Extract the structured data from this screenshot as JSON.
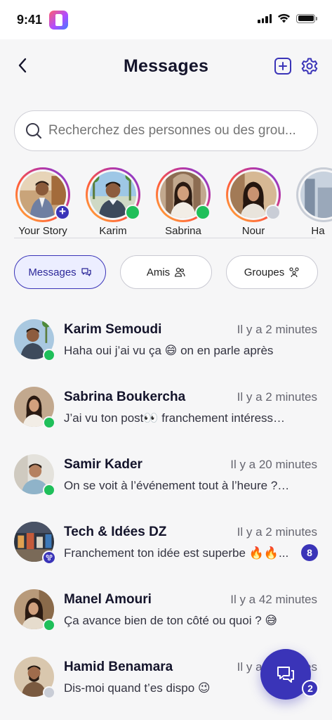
{
  "status_bar": {
    "time": "9:41"
  },
  "header": {
    "title": "Messages"
  },
  "search": {
    "placeholder": "Recherchez des personnes ou des grou..."
  },
  "stories": [
    {
      "name": "Your Story",
      "status": "add"
    },
    {
      "name": "Karim",
      "status": "online"
    },
    {
      "name": "Sabrina",
      "status": "online"
    },
    {
      "name": "Nour",
      "status": "offline"
    },
    {
      "name": "Ha",
      "status": "none"
    }
  ],
  "tabs": [
    {
      "label": "Messages",
      "active": true,
      "icon": "chat-bubbles-icon"
    },
    {
      "label": "Amis",
      "active": false,
      "icon": "users-icon"
    },
    {
      "label": "Groupes",
      "active": false,
      "icon": "group-icon"
    }
  ],
  "conversations": [
    {
      "name": "Karim Semoudi",
      "time": "Il y a 2 minutes",
      "message": "Haha oui j’ai vu ça 😄 on en parle après",
      "status": "online"
    },
    {
      "name": "Sabrina Boukercha",
      "time": "Il y a 2 minutes",
      "message": "J’ai vu ton post👀 franchement intéressant 👍",
      "status": "online"
    },
    {
      "name": "Samir Kader",
      "time": "Il y a 20 minutes",
      "message": "On se voit à l’événement tout à l’heure ? 🙂",
      "status": "online"
    },
    {
      "name": "Tech & Idées DZ",
      "time": "Il y a 2 minutes",
      "message": "Franchement ton idée est superbe 🔥🔥...",
      "status": "group",
      "unread": "8"
    },
    {
      "name": "Manel Amouri",
      "time": "Il y a 42 minutes",
      "message": "Ça avance bien de ton côté ou quoi ? 😅",
      "status": "online"
    },
    {
      "name": "Hamid Benamara",
      "time": "Il y a 2 minutes",
      "message": "Dis-moi quand t’es dispo 😉",
      "status": "offline"
    }
  ],
  "fab": {
    "badge": "2",
    "icon": "chat-plus-icon"
  },
  "colors": {
    "accent": "#3a34b8",
    "online": "#1fbf5a",
    "background": "#f6f6f7"
  }
}
